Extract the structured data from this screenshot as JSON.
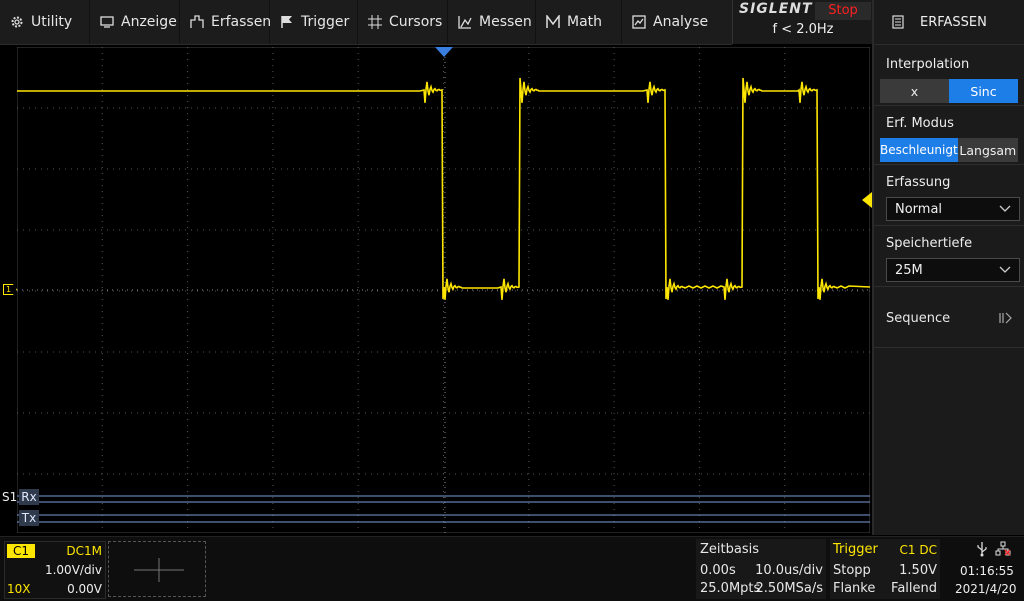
{
  "menu": [
    {
      "label": "Utility",
      "icon": "gear-icon"
    },
    {
      "label": "Anzeige",
      "icon": "monitor-icon"
    },
    {
      "label": "Erfassen",
      "icon": "acquire-icon"
    },
    {
      "label": "Trigger",
      "icon": "flag-icon"
    },
    {
      "label": "Cursors",
      "icon": "cursor-cross-icon"
    },
    {
      "label": "Messen",
      "icon": "measure-icon"
    },
    {
      "label": "Math",
      "icon": "math-icon"
    },
    {
      "label": "Analyse",
      "icon": "analyse-icon"
    }
  ],
  "brand": {
    "name": "SIGLENT",
    "state": "Stop",
    "freq": "f < 2.0Hz"
  },
  "side": {
    "title": "ERFASSEN",
    "interpolation": {
      "label": "Interpolation",
      "options": [
        "x",
        "Sinc"
      ],
      "selected": "Sinc"
    },
    "mode": {
      "label": "Erf. Modus",
      "options": [
        "Beschleunigt",
        "Langsam"
      ],
      "selected": "Beschleunigt"
    },
    "acquisition": {
      "label": "Erfassung",
      "value": "Normal"
    },
    "depth": {
      "label": "Speichertiefe",
      "value": "25M"
    },
    "sequence": {
      "label": "Sequence"
    }
  },
  "channel": {
    "name": "C1",
    "coupling": "DC1M",
    "scale": "1.00V/div",
    "probe": "10X",
    "offset": "0.00V",
    "marker": "1"
  },
  "bus": {
    "label": "S1",
    "lines": [
      "Rx",
      "Tx"
    ]
  },
  "timebase": {
    "title": "Zeitbasis",
    "delay": "0.00s",
    "scale": "10.0us/div",
    "points": "25.0Mpts",
    "rate": "2.50MSa/s"
  },
  "trigger": {
    "title": "Trigger",
    "source": "C1 DC",
    "mode": "Stopp",
    "level": "1.50V",
    "type": "Flanke",
    "slope": "Fallend"
  },
  "status": {
    "time": "01:16:55",
    "date": "2021/4/20"
  },
  "colors": {
    "trace": "#ffe600",
    "accent": "#1e7ee8",
    "stop": "#ff2020"
  }
}
